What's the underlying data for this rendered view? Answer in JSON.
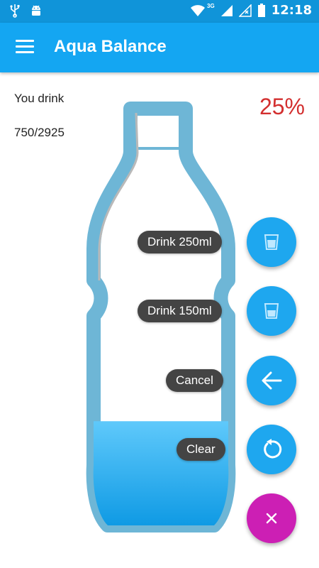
{
  "status_bar": {
    "time": "12:18",
    "network_type": "3G",
    "icons": [
      "usb-icon",
      "android-icon",
      "wifi-icon",
      "signal-icon",
      "signal-empty-icon",
      "battery-icon"
    ]
  },
  "app_bar": {
    "title": "Aqua Balance",
    "menu_icon": "hamburger-icon"
  },
  "stats": {
    "label": "You drink",
    "progress": "750/2925",
    "percent": "25%",
    "fill_fraction": 0.25
  },
  "actions": [
    {
      "label": "Drink 250ml",
      "icon": "glass-icon"
    },
    {
      "label": "Drink 150ml",
      "icon": "glass-icon"
    },
    {
      "label": "Cancel",
      "icon": "arrow-back-icon"
    },
    {
      "label": "Clear",
      "icon": "refresh-icon"
    }
  ],
  "close_fab": {
    "icon": "close-icon"
  },
  "colors": {
    "status_bar": "#1094d9",
    "app_bar": "#14a6f2",
    "fab": "#1ea7ef",
    "close_fab": "#cc1fb4",
    "percent": "#d32f2f",
    "bottle_outline": "#6eb6d6",
    "water": "#2fb3f5"
  }
}
